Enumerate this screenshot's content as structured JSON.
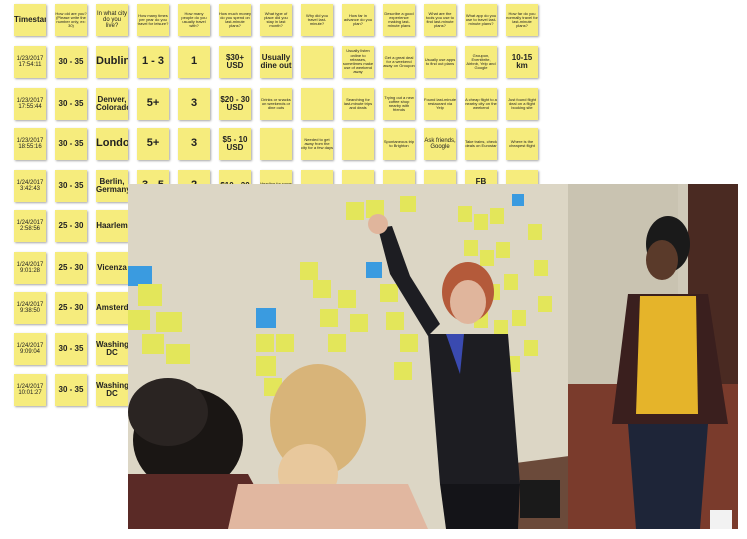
{
  "grid": {
    "rows": [
      {
        "cells": [
          "Timestamp",
          "How old are you? (Please write the number only, ex: 30)",
          "In what city do you live?",
          "How many times per year do you travel for leisure?",
          "How many people do you usually travel with?",
          "How much money do you spend on last-minute plans?",
          "What type of place did you stay in last month?",
          "Why did you travel last-minute?",
          "How far in advance do you plan?",
          "Describe a good experience making last-minute plans",
          "What are the tools you use to find last-minute plans?",
          "What app do you use to travel last-minute plans?",
          "How far do you normally travel for last-minute plans?"
        ]
      },
      {
        "cells": [
          "1/23/2017 17:54:11",
          "30 - 35",
          "Dublin",
          "1 - 3",
          "1",
          "$30+ USD",
          "Usually dine out",
          "",
          "Usually listen online to releases, sometimes make use of weekend away",
          "Get a great deal for a weekend away on Groupon",
          "Usually use apps to find out plans",
          "Groupon, Eventbrite, Airbnb, Yelp and Google",
          "10-15 km"
        ]
      },
      {
        "cells": [
          "1/23/2017 17:55:44",
          "30 - 35",
          "Denver, Colorado",
          "5+",
          "3",
          "$20 - 30 USD",
          "Drinks or snacks on weekends or dine outs",
          "",
          "Searching for last-minute trips and deals",
          "Trying out a new coffee shop nearby with friends",
          "Found last-minute restaurant via Yelp",
          "A cheap flight to a nearby city on the weekend",
          "Just found flight deal on a flight booking site"
        ]
      },
      {
        "cells": [
          "1/23/2017 18:55:16",
          "30 - 35",
          "London",
          "5+",
          "3",
          "$5 - 10 USD",
          "",
          "Needed to get away from the city for a few days",
          "",
          "Spontaneous trip to Brighton",
          "Ask friends, Google",
          "Take trains, check deals on Eurostar",
          "Where is the cheapest flight"
        ]
      },
      {
        "cells": [
          "1/24/2017 3:42:43",
          "30 - 35",
          "Berlin, Germany",
          "3 - 5",
          "2",
          "$10 - 20",
          "Heading for some drinks with friends",
          "",
          "",
          "",
          "",
          "FB messenger",
          ""
        ]
      },
      {
        "cells": [
          "1/24/2017 2:58:56",
          "25 - 30",
          "Haarlem"
        ]
      },
      {
        "cells": [
          "1/24/2017 9:01:28",
          "25 - 30",
          "Vicenza"
        ]
      },
      {
        "cells": [
          "1/24/2017 9:38:50",
          "25 - 30",
          "Amsterdam"
        ]
      },
      {
        "cells": [
          "1/24/2017 9:09:04",
          "30 - 35",
          "Washington, DC"
        ]
      },
      {
        "cells": [
          "1/24/2017 10:01:27",
          "30 - 35",
          "Washington DC"
        ]
      }
    ]
  },
  "photo": {
    "description_icon": "workshop-photo",
    "colors": {
      "wall": "#d9d3c2",
      "note_yellow": "#e3e65a",
      "note_blue": "#3a9be0",
      "jacket": "#1d1d22",
      "shirt_yellow": "#e5b42a"
    }
  }
}
